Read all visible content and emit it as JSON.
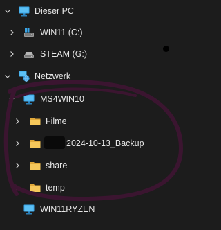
{
  "tree": {
    "items": [
      {
        "label": "Dieser PC",
        "icon": "monitor-icon",
        "expanded": true
      },
      {
        "label": "WIN11 (C:)",
        "icon": "windows-drive-icon",
        "expanded": false
      },
      {
        "label": "STEAM (G:)",
        "icon": "drive-icon",
        "expanded": false
      },
      {
        "label": "Netzwerk",
        "icon": "network-icon",
        "expanded": true
      },
      {
        "label": "MS4WIN10",
        "icon": "monitor-icon",
        "expanded": true
      },
      {
        "label": "Filme",
        "icon": "folder-icon",
        "expanded": false
      },
      {
        "label": "2024-10-13_Backup",
        "icon": "folder-icon",
        "expanded": false
      },
      {
        "label": "share",
        "icon": "folder-icon",
        "expanded": false
      },
      {
        "label": "temp",
        "icon": "folder-icon",
        "expanded": false
      },
      {
        "label": "WIN11RYZEN",
        "icon": "monitor-icon",
        "expanded": false
      }
    ]
  },
  "colors": {
    "background": "#1c1c1c",
    "text": "#e6e6e6",
    "chevron": "#cfcfcf",
    "monitor": "#3aa6e8",
    "folder": "#f2c14e",
    "scribble": "#3b1530"
  }
}
